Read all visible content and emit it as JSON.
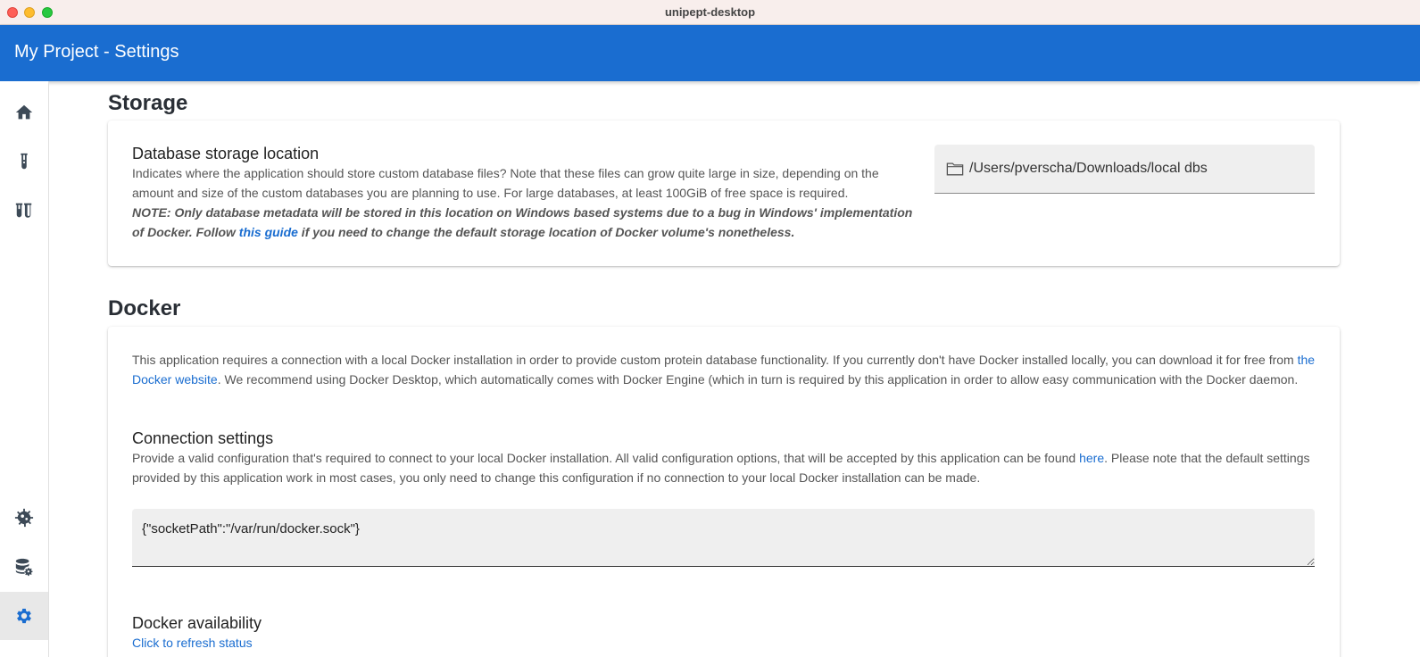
{
  "window": {
    "title": "unipept-desktop"
  },
  "appbar": {
    "title": "My Project - Settings"
  },
  "sidebar": {
    "items": [
      {
        "icon": "home-icon"
      },
      {
        "icon": "test-tube-icon"
      },
      {
        "icon": "test-tubes-icon"
      },
      {
        "icon": "virus-icon"
      },
      {
        "icon": "database-settings-icon"
      },
      {
        "icon": "gear-icon",
        "active": true
      }
    ]
  },
  "storage": {
    "title": "Storage",
    "heading": "Database storage location",
    "description": "Indicates where the application should store custom database files? Note that these files can grow quite large in size, depending on the amount and size of the custom databases you are planning to use. For large databases, at least 100GiB of free space is required.",
    "note_before": "NOTE: Only database metadata will be stored in this location on Windows based systems due to a bug in Windows' implementation of Docker. Follow ",
    "note_link": "this guide",
    "note_after": " if you need to change the default storage location of Docker volume's nonetheless.",
    "location_value": "/Users/pverscha/Downloads/local dbs"
  },
  "docker": {
    "title": "Docker",
    "intro_before": "This application requires a connection with a local Docker installation in order to provide custom protein database functionality. If you currently don't have Docker installed locally, you can download it for free from ",
    "intro_link": "the Docker website",
    "intro_after": ". We recommend using Docker Desktop, which automatically comes with Docker Engine (which in turn is required by this application in order to allow easy communication with the Docker daemon.",
    "connection_heading": "Connection settings",
    "connection_before": "Provide a valid configuration that's required to connect to your local Docker installation. All valid configuration options, that will be accepted by this application can be found ",
    "connection_link": "here",
    "connection_after": ". Please note that the default settings provided by this application work in most cases, you only need to change this configuration if no connection to your local Docker installation can be made.",
    "config_value": "{\"socketPath\":\"/var/run/docker.sock\"}",
    "availability_heading": "Docker availability",
    "refresh_link": "Click to refresh status"
  },
  "colors": {
    "appbar": "#1a6dd0",
    "link": "#1a6dd0",
    "sidebar_icon": "#3d4a57",
    "active_icon": "#1a6dd0"
  }
}
